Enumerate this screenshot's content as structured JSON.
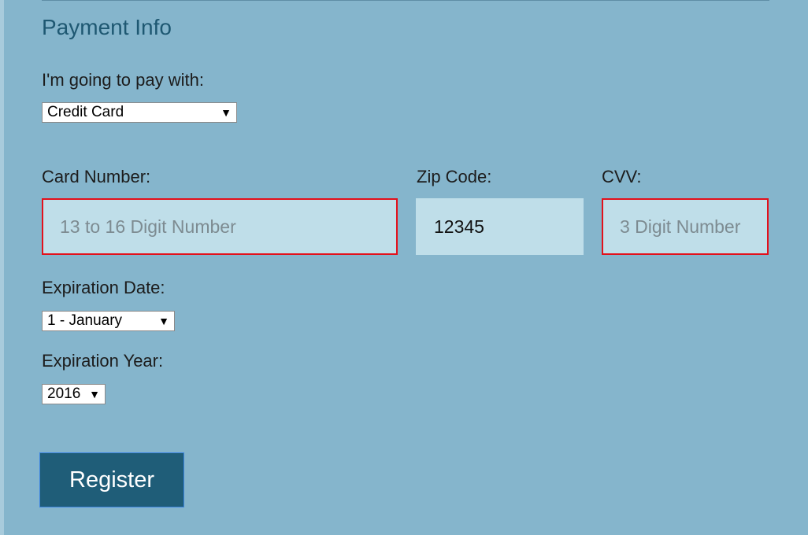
{
  "payment": {
    "title": "Payment Info",
    "pay_with_label": "I'm going to pay with:",
    "pay_with_selected": "Credit Card"
  },
  "card": {
    "number_label": "Card Number:",
    "number_placeholder": "13 to 16 Digit Number",
    "zip_label": "Zip Code:",
    "zip_value": "12345",
    "cvv_label": "CVV:",
    "cvv_placeholder": "3 Digit Number"
  },
  "expiration": {
    "date_label": "Expiration Date:",
    "month_selected": "1 - January",
    "year_label": "Expiration Year:",
    "year_selected": "2016"
  },
  "actions": {
    "register_label": "Register"
  },
  "icons": {
    "dropdown_arrow": "▼"
  },
  "colors": {
    "background": "#85b5cc",
    "title": "#1e5872",
    "field_bg": "#bfdee9",
    "error_border": "#e3101b",
    "button_bg": "#1f5d78"
  }
}
